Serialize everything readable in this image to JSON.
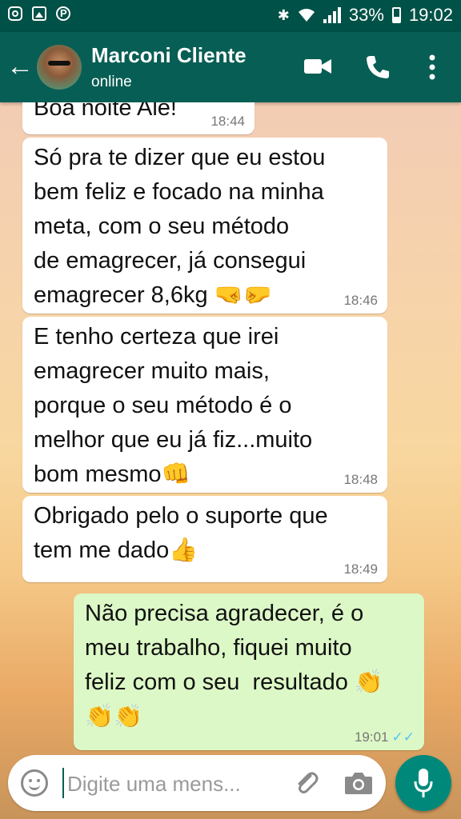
{
  "status_bar": {
    "battery": "33%",
    "time": "19:02"
  },
  "header": {
    "contact_name": "Marconi Cliente",
    "contact_status": "online"
  },
  "messages": [
    {
      "direction": "in",
      "text": "Boa noite Ale!",
      "time": "18:44"
    },
    {
      "direction": "in",
      "text": "Só pra te dizer que eu estou\nbem feliz e focado na minha\nmeta, com o seu método\nde emagrecer, já consegui\nemagrecer 8,6kg 🤜🤛",
      "time": "18:46"
    },
    {
      "direction": "in",
      "text": "E tenho certeza que irei\nemagrecer muito mais,\nporque o seu método é o\nmelhor que eu já fiz...muito\nbom mesmo👊",
      "time": "18:48"
    },
    {
      "direction": "in",
      "text": "Obrigado pelo o suporte que\ntem me dado👍",
      "time": "18:49"
    },
    {
      "direction": "out",
      "text": "Não precisa agradecer, é o\nmeu trabalho, fiquei muito\nfeliz com o seu  resultado 👏\n👏👏",
      "time": "19:01",
      "ticks": "✓✓"
    }
  ],
  "composer": {
    "placeholder": "Digite uma mens..."
  },
  "colors": {
    "header": "#075e54",
    "status_bar": "#005147",
    "incoming_bubble": "#ffffff",
    "outgoing_bubble": "#dcf8c6",
    "mic_button": "#00897b",
    "read_ticks": "#4fc3f7"
  },
  "icons": [
    "instagram-icon",
    "gallery-icon",
    "pinterest-icon",
    "bluetooth-icon",
    "wifi-icon",
    "signal-icon",
    "battery-icon",
    "back-arrow-icon",
    "video-call-icon",
    "phone-icon",
    "more-options-icon",
    "emoji-icon",
    "attach-icon",
    "camera-icon",
    "mic-icon"
  ]
}
